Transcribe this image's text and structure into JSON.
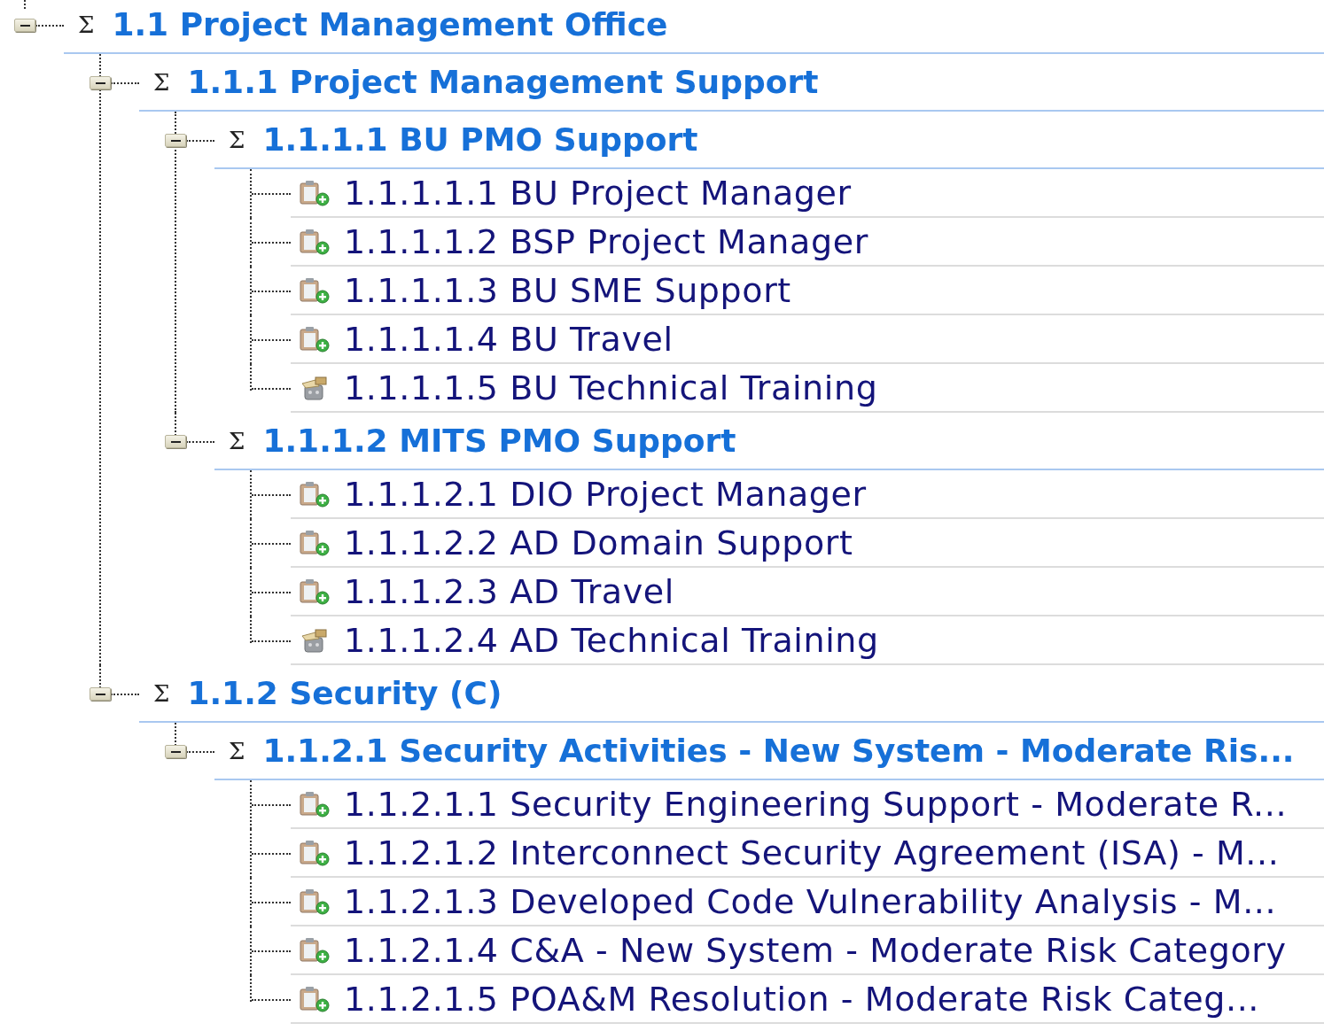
{
  "tree": [
    {
      "kind": "summary",
      "expanded": true,
      "sigma": "Σ",
      "label": "1.1 Project Management Office",
      "children": [
        {
          "kind": "summary",
          "expanded": true,
          "sigma": "Σ",
          "label": "1.1.1 Project Management Support",
          "children": [
            {
              "kind": "summary",
              "expanded": true,
              "sigma": "Σ",
              "label": "1.1.1.1 BU PMO Support",
              "children": [
                {
                  "kind": "task",
                  "label": "1.1.1.1.1 BU Project Manager"
                },
                {
                  "kind": "task",
                  "label": "1.1.1.1.2 BSP Project Manager"
                },
                {
                  "kind": "task",
                  "label": "1.1.1.1.3 BU SME Support"
                },
                {
                  "kind": "task",
                  "label": "1.1.1.1.4 BU Travel"
                },
                {
                  "kind": "package",
                  "label": "1.1.1.1.5 BU Technical Training"
                }
              ]
            },
            {
              "kind": "summary",
              "expanded": true,
              "sigma": "Σ",
              "label": "1.1.1.2 MITS PMO Support",
              "children": [
                {
                  "kind": "task",
                  "label": "1.1.1.2.1 DIO Project Manager"
                },
                {
                  "kind": "task",
                  "label": "1.1.1.2.2 AD Domain Support"
                },
                {
                  "kind": "task",
                  "label": "1.1.1.2.3 AD Travel"
                },
                {
                  "kind": "package",
                  "label": "1.1.1.2.4 AD Technical Training"
                }
              ]
            }
          ]
        },
        {
          "kind": "summary",
          "expanded": true,
          "sigma": "Σ",
          "label": "1.1.2 Security (C)",
          "children": [
            {
              "kind": "summary",
              "expanded": true,
              "sigma": "Σ",
              "label": "1.1.2.1 Security Activities - New System - Moderate Ris...",
              "children": [
                {
                  "kind": "task",
                  "label": "1.1.2.1.1 Security Engineering Support - Moderate R..."
                },
                {
                  "kind": "task",
                  "label": "1.1.2.1.2 Interconnect Security Agreement (ISA) - M..."
                },
                {
                  "kind": "task",
                  "label": "1.1.2.1.3 Developed Code Vulnerability Analysis - M..."
                },
                {
                  "kind": "task",
                  "label": "1.1.2.1.4 C&A - New System - Moderate Risk Category"
                },
                {
                  "kind": "task",
                  "label": "1.1.2.1.5 POA&M Resolution - Moderate Risk Categ..."
                }
              ]
            }
          ]
        }
      ]
    }
  ]
}
